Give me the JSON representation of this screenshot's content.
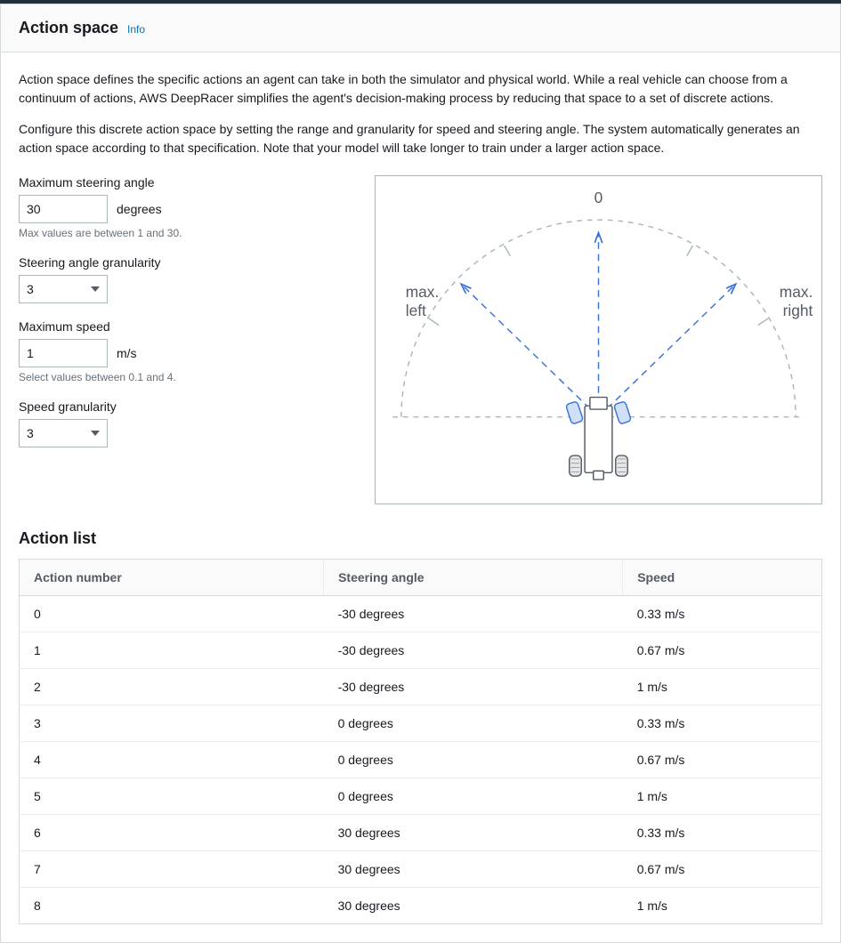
{
  "header": {
    "title": "Action space",
    "info": "Info"
  },
  "description": {
    "p1": "Action space defines the specific actions an agent can take in both the simulator and physical world. While a real vehicle can choose from a continuum of actions, AWS DeepRacer simplifies the agent's decision-making process by reducing that space to a set of discrete actions.",
    "p2": "Configure this discrete action space by setting the range and granularity for speed and steering angle. The system automatically generates an action space according to that specification. Note that your model will take longer to train under a larger action space."
  },
  "fields": {
    "max_steering": {
      "label": "Maximum steering angle",
      "value": "30",
      "unit": "degrees",
      "hint": "Max values are between 1 and 30."
    },
    "steering_gran": {
      "label": "Steering angle granularity",
      "value": "3"
    },
    "max_speed": {
      "label": "Maximum speed",
      "value": "1",
      "unit": "m/s",
      "hint": "Select values between 0.1 and 4."
    },
    "speed_gran": {
      "label": "Speed granularity",
      "value": "3"
    }
  },
  "diagram": {
    "zero": "0",
    "left": "max.\nleft",
    "right": "max.\nright"
  },
  "action_list": {
    "title": "Action list",
    "columns": {
      "action": "Action number",
      "steering": "Steering angle",
      "speed": "Speed"
    },
    "rows": [
      {
        "n": "0",
        "steering": "-30 degrees",
        "speed": "0.33 m/s"
      },
      {
        "n": "1",
        "steering": "-30 degrees",
        "speed": "0.67 m/s"
      },
      {
        "n": "2",
        "steering": "-30 degrees",
        "speed": "1 m/s"
      },
      {
        "n": "3",
        "steering": "0 degrees",
        "speed": "0.33 m/s"
      },
      {
        "n": "4",
        "steering": "0 degrees",
        "speed": "0.67 m/s"
      },
      {
        "n": "5",
        "steering": "0 degrees",
        "speed": "1 m/s"
      },
      {
        "n": "6",
        "steering": "30 degrees",
        "speed": "0.33 m/s"
      },
      {
        "n": "7",
        "steering": "30 degrees",
        "speed": "0.67 m/s"
      },
      {
        "n": "8",
        "steering": "30 degrees",
        "speed": "1 m/s"
      }
    ]
  }
}
